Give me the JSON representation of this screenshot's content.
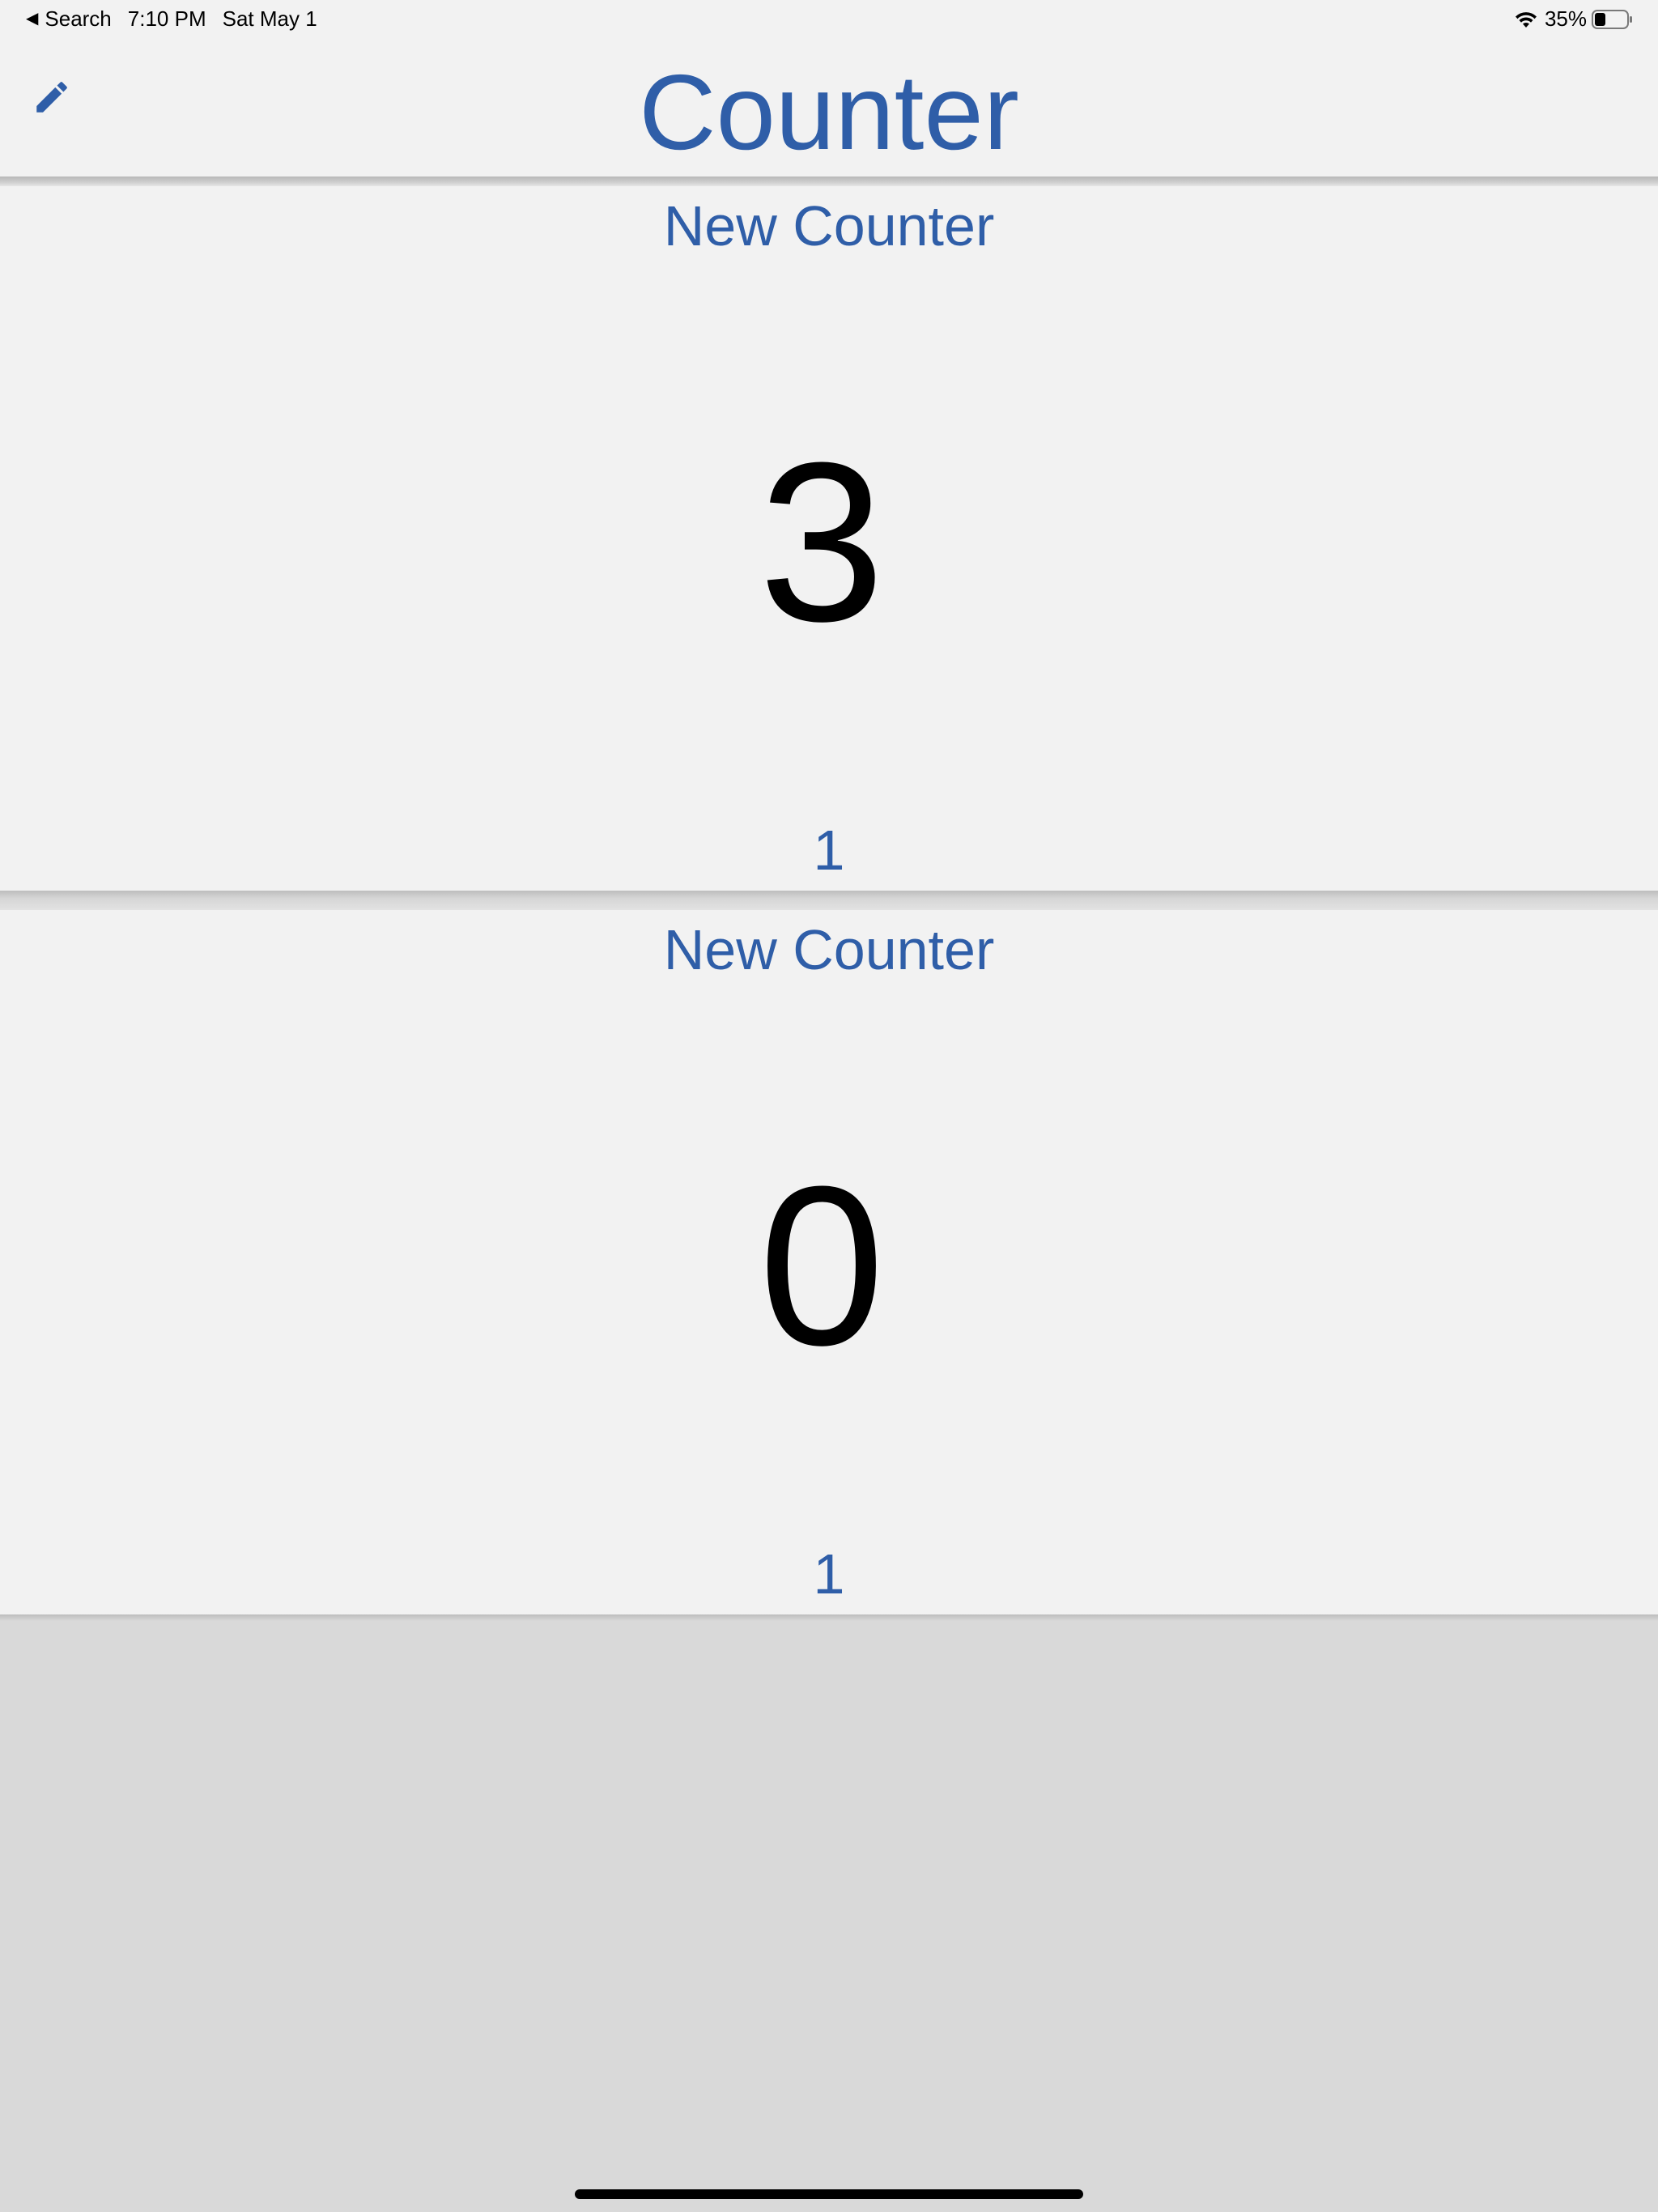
{
  "status_bar": {
    "back_label": "Search",
    "time": "7:10 PM",
    "date": "Sat May 1",
    "battery_percent": "35%",
    "battery_level": 0.35
  },
  "nav": {
    "title": "Counter",
    "edit_icon": "pencil-icon"
  },
  "counters": [
    {
      "name": "New Counter",
      "value": "3",
      "step": "1"
    },
    {
      "name": "New Counter",
      "value": "0",
      "step": "1"
    }
  ],
  "colors": {
    "accent": "#2f5ea8",
    "card_background": "#f2f2f2",
    "empty_background": "#d9d9d9"
  }
}
